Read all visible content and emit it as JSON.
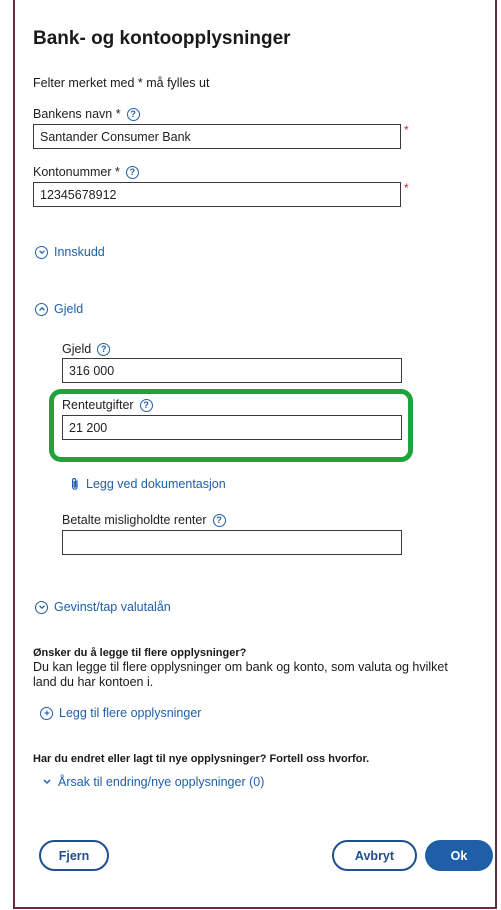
{
  "dialog": {
    "title": "Bank- og kontoopplysninger",
    "required_note": "Felter merket med * må fylles ut"
  },
  "fields": {
    "bank_name": {
      "label": "Bankens navn *",
      "value": "Santander Consumer Bank",
      "required_mark": "*"
    },
    "account_number": {
      "label": "Kontonummer *",
      "value": "12345678912",
      "required_mark": "*"
    }
  },
  "sections": {
    "deposits": {
      "label": "Innskudd",
      "state": "collapsed"
    },
    "debt": {
      "label": "Gjeld",
      "state": "expanded",
      "debt_field": {
        "label": "Gjeld",
        "value": "316 000"
      },
      "interest_field": {
        "label": "Renteutgifter",
        "value": "21 200"
      },
      "attach_link": "Legg ved dokumentasjon",
      "default_interest_field": {
        "label": "Betalte misligholdte renter",
        "value": ""
      }
    },
    "currency_loan": {
      "label": "Gevinst/tap valutalån",
      "state": "collapsed"
    }
  },
  "more_info": {
    "heading": "Ønsker du å legge til flere opplysninger?",
    "text": "Du kan legge til flere opplysninger om bank og konto, som valuta og hvilket land du har kontoen i.",
    "add_link": "Legg til flere opplysninger"
  },
  "change_reason": {
    "heading": "Har du endret eller lagt til nye opplysninger? Fortell oss hvorfor.",
    "toggle_label": "Årsak til endring/nye opplysninger (0)"
  },
  "buttons": {
    "remove": "Fjern",
    "cancel": "Avbryt",
    "ok": "Ok"
  },
  "colors": {
    "accent": "#1f5fa8",
    "highlight": "#1fa23c",
    "required": "#dd2222"
  },
  "icons": {
    "help": "question-circle-icon",
    "chevron_circle": "chevron-circle-icon",
    "paperclip": "paperclip-icon",
    "plus_circle": "plus-circle-icon",
    "chevron_down": "chevron-down-icon"
  }
}
